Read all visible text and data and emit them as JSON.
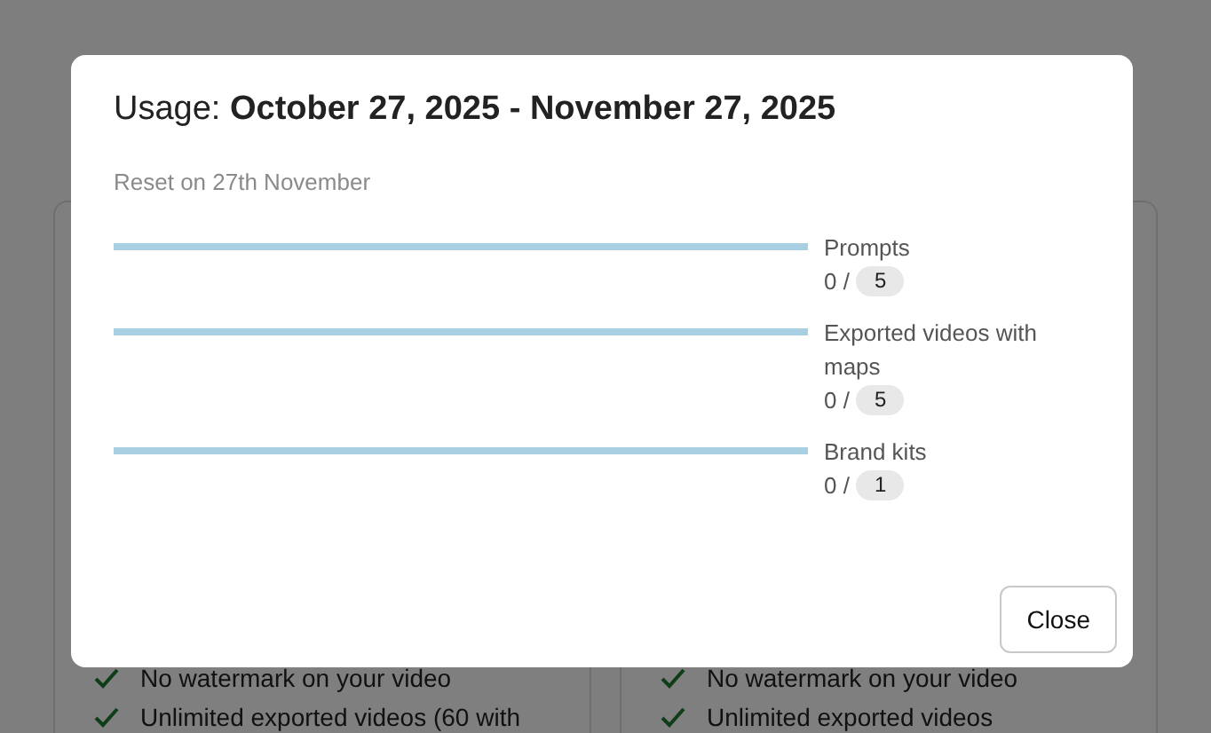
{
  "background_cards": [
    {
      "features": [
        "No watermark on your video",
        "Unlimited exported videos (60 with"
      ]
    },
    {
      "features": [
        "No watermark on your video",
        "Unlimited exported videos"
      ]
    }
  ],
  "dialog": {
    "title": "Usage: **October 27, 2025 - November 27, 2025**",
    "subtitle": "Reset on 27th November",
    "quotas": [
      {
        "label": "Prompts",
        "used": "0 /",
        "limit": "5",
        "level": 0
      },
      {
        "label": "Exported videos with maps",
        "used": "0 /",
        "limit": "5",
        "level": 0
      },
      {
        "label": "Brand kits",
        "used": "0 /",
        "limit": "1",
        "level": 0
      }
    ],
    "close_button": "Close"
  }
}
